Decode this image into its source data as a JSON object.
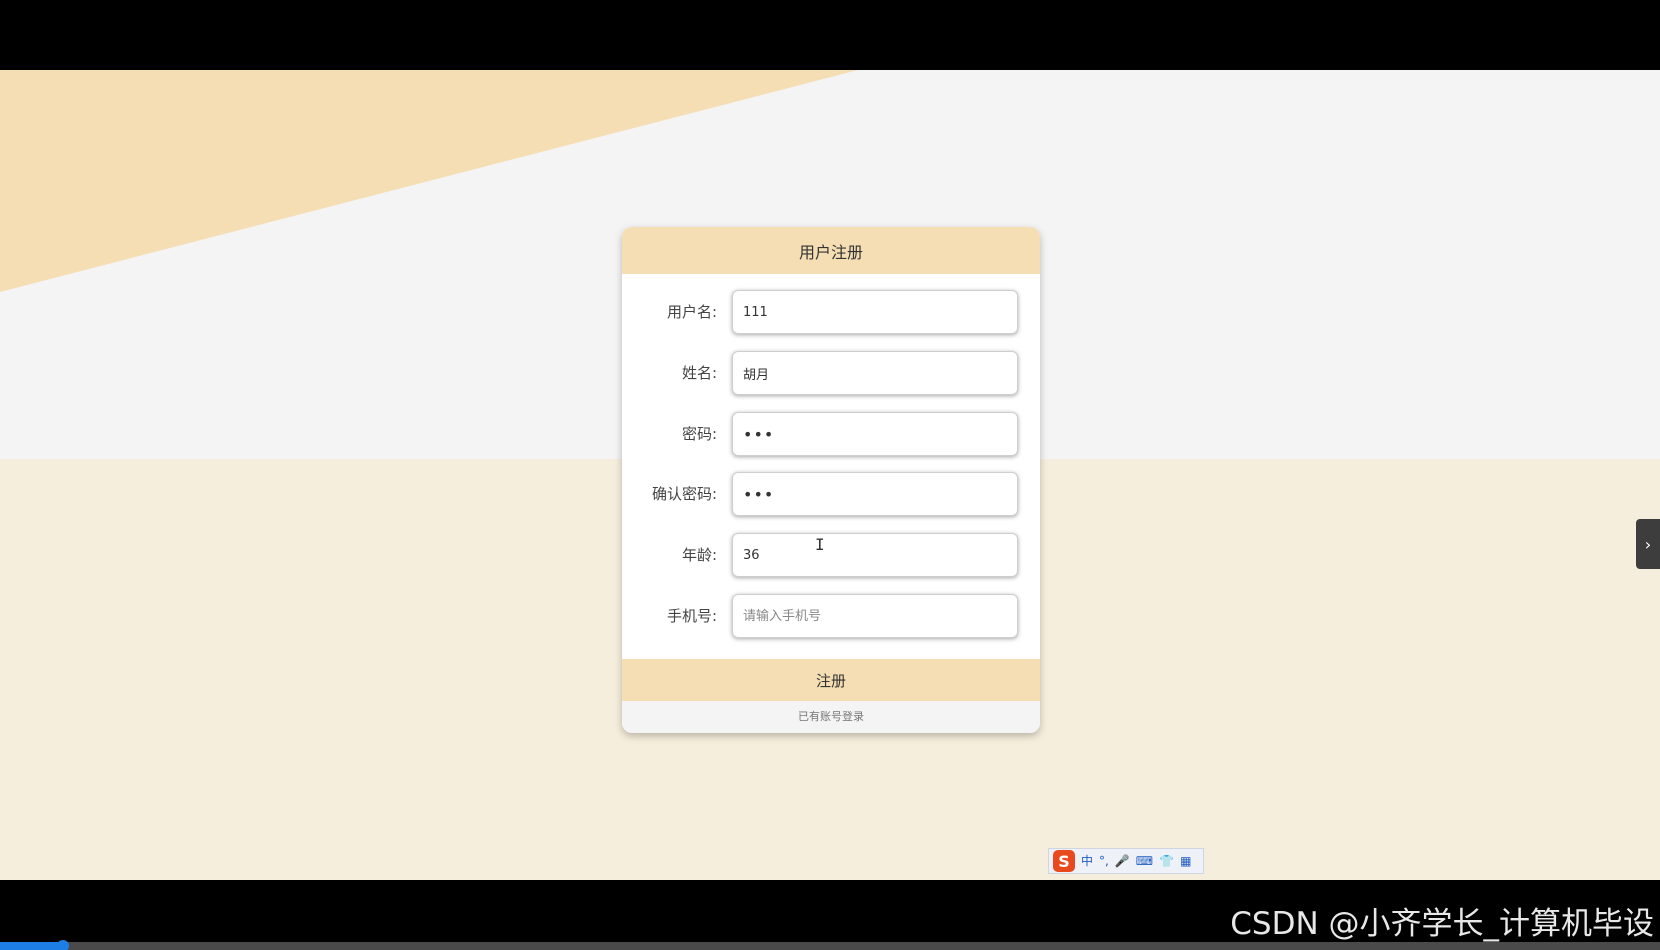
{
  "form": {
    "title": "用户注册",
    "fields": [
      {
        "label": "用户名:",
        "value": "111",
        "placeholder": ""
      },
      {
        "label": "姓名:",
        "value": "胡月",
        "placeholder": ""
      },
      {
        "label": "密码:",
        "value": "•••",
        "placeholder": ""
      },
      {
        "label": "确认密码:",
        "value": "•••",
        "placeholder": ""
      },
      {
        "label": "年龄:",
        "value": "36",
        "placeholder": ""
      },
      {
        "label": "手机号:",
        "value": "",
        "placeholder": "请输入手机号"
      }
    ],
    "submit_label": "注册",
    "login_link": "已有账号登录"
  },
  "ime_toolbar": {
    "logo": "S",
    "mode": "中",
    "punct": "°,",
    "voice_icon": "🎤",
    "keyboard_icon": "⌨",
    "skin_icon": "👕",
    "apps_icon": "▦"
  },
  "side_tab": {
    "icon": "›"
  },
  "watermark": "CSDN @小齐学长_计算机毕设",
  "video_progress": {
    "fraction": 0.038
  },
  "colors": {
    "accent": "#f5deb3",
    "background_top": "#f4f4f4",
    "background_bottom": "#f6eedc",
    "progress": "#1d7fe6"
  }
}
